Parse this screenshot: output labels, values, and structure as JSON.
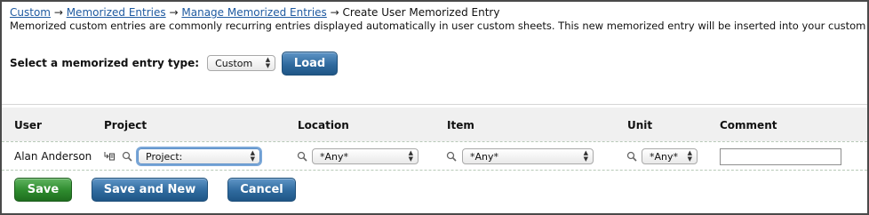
{
  "breadcrumb": {
    "links": [
      "Custom",
      "Memorized Entries",
      "Manage Memorized Entries"
    ],
    "separator": "→",
    "current": "Create User Memorized Entry"
  },
  "description": "Memorized custom entries are commonly recurring entries displayed automatically in user custom sheets. This new memorized entry will be inserted into your custom sheets.",
  "entry_type": {
    "label": "Select a memorized entry type:",
    "selected": "Custom",
    "load_button": "Load"
  },
  "table": {
    "columns": [
      "User",
      "Project",
      "Location",
      "Item",
      "Unit",
      "Comment"
    ],
    "row": {
      "user": "Alan Anderson",
      "project": "Project:",
      "location": "*Any*",
      "item": "*Any*",
      "unit": "*Any*",
      "comment": ""
    }
  },
  "actions": {
    "save": "Save",
    "save_and_new": "Save and New",
    "cancel": "Cancel"
  },
  "colors": {
    "link": "#1f5aa0",
    "primary_button": "#2f6a9e",
    "save_button": "#2d8a2d"
  },
  "icons": [
    "hierarchy-icon",
    "search-icon"
  ]
}
